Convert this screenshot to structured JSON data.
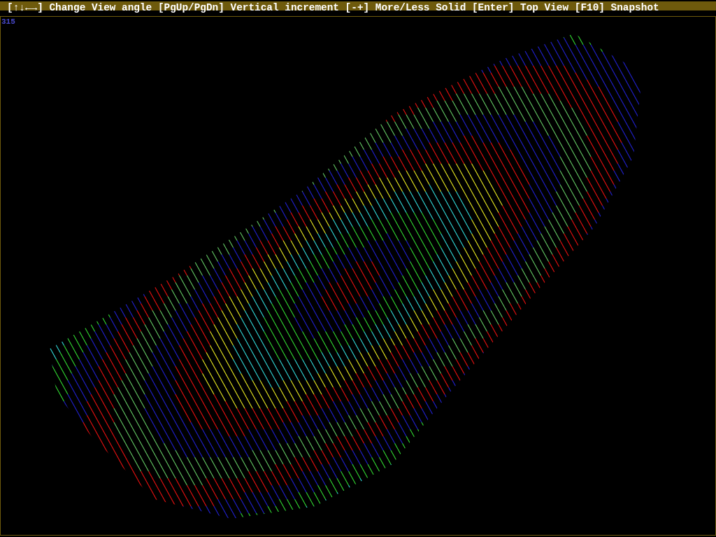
{
  "hint_bar": {
    "text": "[↑↓←→] Change View angle [PgUp/PgDn] Vertical increment [-+] More/Less Solid [Enter] Top View [F10] Snapshot"
  },
  "viewport": {
    "angle_label": "315"
  }
}
